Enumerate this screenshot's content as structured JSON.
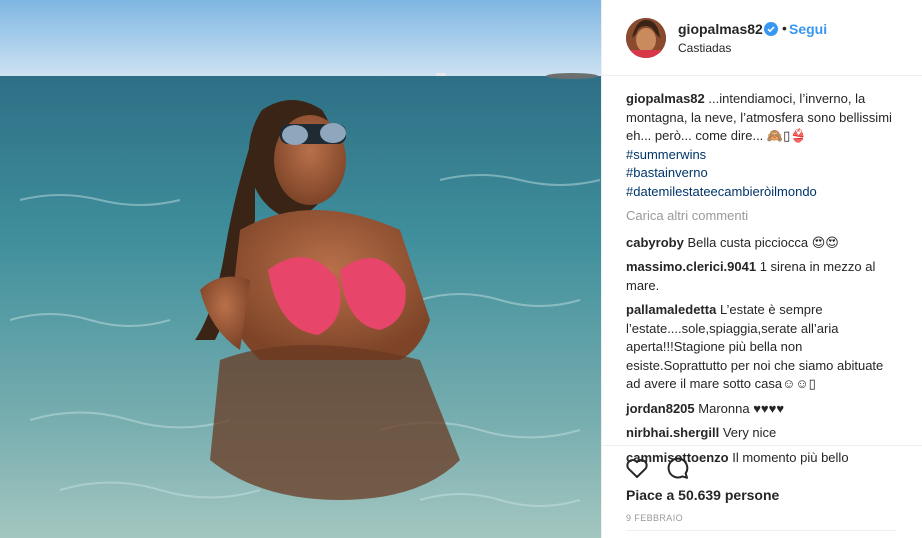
{
  "header": {
    "username": "giopalmas82",
    "separator": "•",
    "follow_label": "Segui",
    "location": "Castiadas"
  },
  "caption": {
    "username": "giopalmas82",
    "text": "...intendiamoci, l’inverno, la montagna, la neve, l’atmosfera sono bellissimi eh... però... come dire... 🙈▯👙",
    "tags": [
      "#summerwins",
      "#bastainverno",
      "#datemilestateecambieròilmondo"
    ]
  },
  "load_more": "Carica altri commenti",
  "comments": [
    {
      "user": "cabyroby",
      "text": "Bella custa picciocca 😍😍"
    },
    {
      "user": "massimo.clerici.9041",
      "text": "1 sirena in mezzo al mare."
    },
    {
      "user": "pallamaledetta",
      "text": "L’estate è sempre l’estate....sole,spiaggia,serate all’aria aperta!!!Stagione più bella non esiste.Soprattutto per noi che siamo abituate ad avere il mare sotto casa☺☺▯"
    },
    {
      "user": "jordan8205",
      "text": "Maronna ♥♥♥♥"
    },
    {
      "user": "nirbhai.shergill",
      "text": "Very nice"
    },
    {
      "user": "cammisottoenzo",
      "text": "Il momento più bello"
    }
  ],
  "actions": {
    "like_icon": "heart-icon",
    "comment_icon": "comment-icon",
    "likes_text": "Piace a 50.639 persone",
    "date": "9 FEBBRAIO"
  },
  "colors": {
    "link_blue": "#3897f0",
    "hashtag": "#003569",
    "muted": "#999999",
    "sea": "#3f8f9c",
    "sky": "#9fc7e8"
  }
}
